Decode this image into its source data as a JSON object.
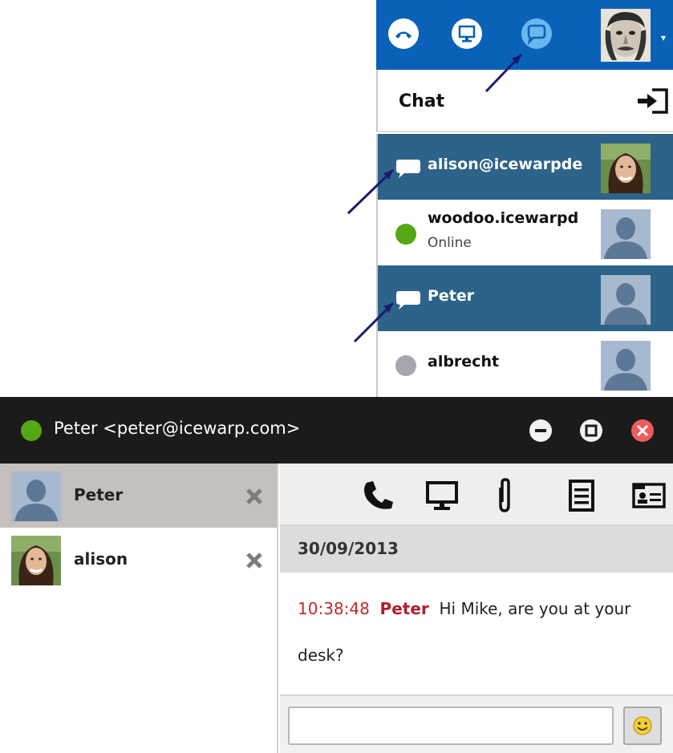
{
  "topbar": {
    "icons": [
      "phone-icon",
      "monitor-icon",
      "chat-bubble-icon"
    ],
    "accent": "#0a62b8",
    "caret": "▾"
  },
  "chat_panel": {
    "title": "Chat",
    "contacts": [
      {
        "name": "alison@icewarpde",
        "status": "",
        "indicator": "chat-bubble-icon",
        "selected": true
      },
      {
        "name": "woodoo.icewarpd",
        "status": "Online",
        "indicator": "online",
        "selected": false
      },
      {
        "name": "Peter",
        "status": "",
        "indicator": "chat-bubble-icon",
        "selected": true
      },
      {
        "name": "albrecht",
        "status": "",
        "indicator": "offline",
        "selected": false
      }
    ],
    "colors": {
      "selected_row": "#2d6389",
      "online": "#54a813",
      "offline": "#a7a7b0"
    }
  },
  "chat_window": {
    "title": "Peter <peter@icewarp.com>",
    "status_color": "#54a813",
    "window_controls": [
      "minimize-icon",
      "maximize-icon",
      "close-icon"
    ],
    "tabs": [
      {
        "name": "Peter",
        "active": true
      },
      {
        "name": "alison",
        "active": false
      }
    ],
    "toolbar": [
      "phone-icon",
      "monitor-icon",
      "paperclip-icon",
      "document-icon",
      "contact-card-icon"
    ],
    "date": "30/09/2013",
    "message": {
      "time": "10:38:48",
      "sender": "Peter",
      "text": "Hi Mike, are you at your desk?"
    },
    "input": {
      "value": "",
      "placeholder": ""
    }
  }
}
